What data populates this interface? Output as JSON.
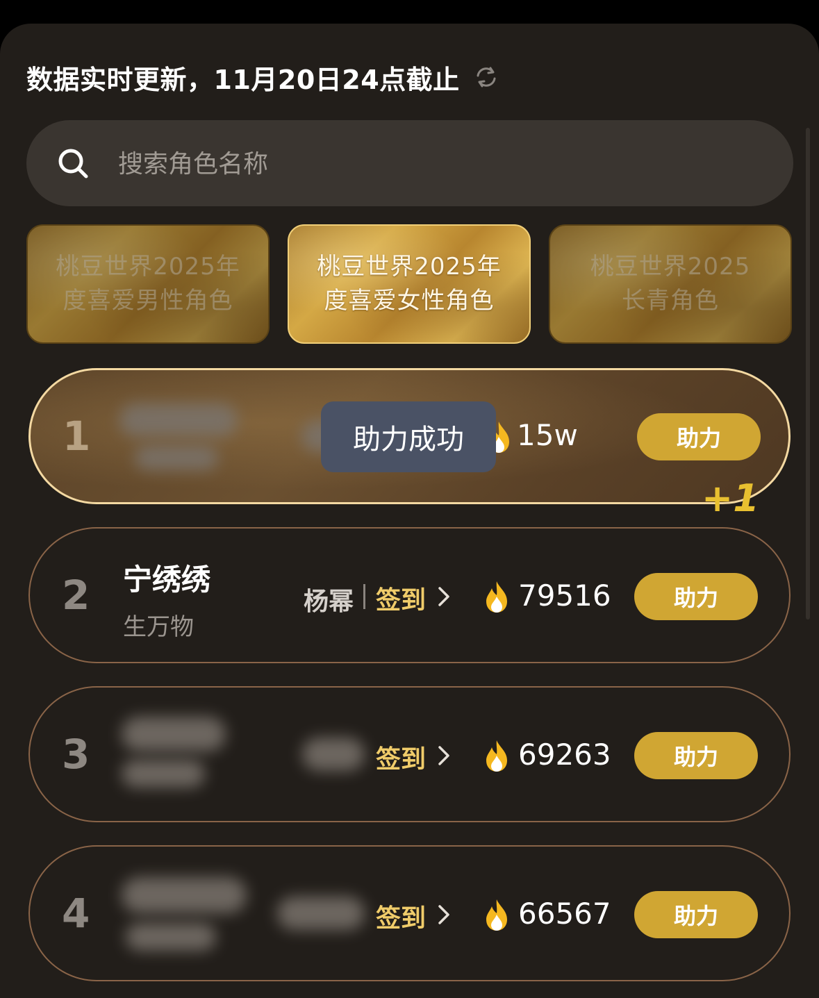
{
  "header": {
    "title": "数据实时更新，11月20日24点截止",
    "refresh_icon": "refresh-icon"
  },
  "search": {
    "placeholder": "搜索角色名称",
    "value": ""
  },
  "category_tabs": [
    {
      "label": "桃豆世界2025年度喜爱男性角色",
      "active": false
    },
    {
      "label": "桃豆世界2025年度喜爱女性角色",
      "active": true
    },
    {
      "label": "桃豆世界2025长青角色",
      "active": false
    }
  ],
  "toast": {
    "text": "助力成功"
  },
  "plus_one": "+1",
  "ranks": [
    {
      "rank": "1",
      "name": "",
      "work": "",
      "actor": "",
      "signin": "",
      "score": "15w",
      "button": "助力"
    },
    {
      "rank": "2",
      "name": "宁绣绣",
      "work": "生万物",
      "actor": "杨幂",
      "signin": "签到",
      "score": "79516",
      "button": "助力"
    },
    {
      "rank": "3",
      "name": "",
      "work": "",
      "actor": "",
      "signin": "签到",
      "score": "69263",
      "button": "助力"
    },
    {
      "rank": "4",
      "name": "",
      "work": "",
      "actor": "",
      "signin": "签到",
      "score": "66567",
      "button": "助力"
    }
  ],
  "colors": {
    "background": "#221e1a",
    "accent_gold": "#d0a633",
    "signin_gold": "#f0cc6a",
    "toast_bg": "#4a5265",
    "card_border": "#8a6448",
    "search_bg": "#3a3530"
  }
}
